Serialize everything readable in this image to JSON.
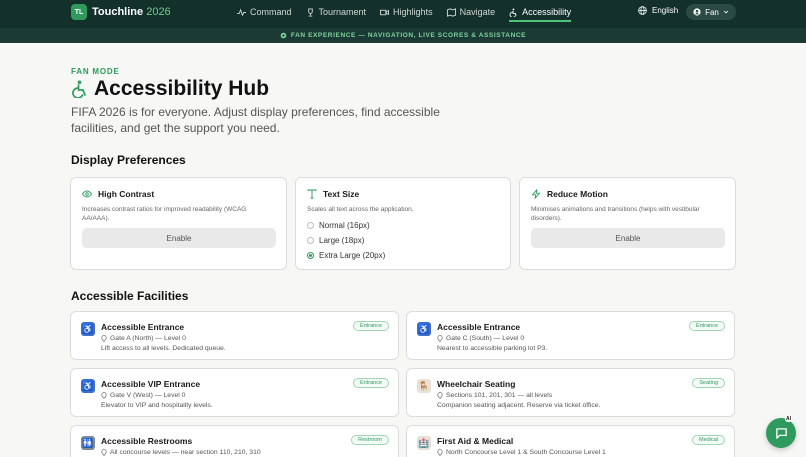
{
  "header": {
    "logo_initials": "TL",
    "brand": "Touchline",
    "brand_year": "2026",
    "nav": [
      {
        "label": "Command",
        "icon": "activity-icon"
      },
      {
        "label": "Tournament",
        "icon": "trophy-icon"
      },
      {
        "label": "Highlights",
        "icon": "video-icon"
      },
      {
        "label": "Navigate",
        "icon": "map-icon"
      },
      {
        "label": "Accessibility",
        "icon": "accessibility-icon",
        "active": true
      }
    ],
    "language": "English",
    "mode_button": "Fan"
  },
  "banner": "FAN EXPERIENCE — NAVIGATION, LIVE SCORES & ASSISTANCE",
  "hero": {
    "eyebrow": "FAN MODE",
    "title": "Accessibility Hub",
    "description": "FIFA 2026 is for everyone. Adjust display preferences, find accessible facilities, and get the support you need."
  },
  "display_preferences": {
    "title": "Display Preferences",
    "high_contrast": {
      "title": "High Contrast",
      "description": "Increases contrast ratios for improved readability (WCAG AA/AAA).",
      "button": "Enable"
    },
    "text_size": {
      "title": "Text Size",
      "description": "Scales all text across the application.",
      "options": [
        "Normal (16px)",
        "Large (18px)",
        "Extra Large (20px)"
      ],
      "selected": "Extra Large (20px)"
    },
    "reduce_motion": {
      "title": "Reduce Motion",
      "description": "Minimises animations and transitions (helps with vestibular disorders).",
      "button": "Enable"
    }
  },
  "facilities": {
    "title": "Accessible Facilities",
    "items": [
      {
        "name": "Accessible Entrance",
        "tag": "Entrance",
        "location": "Gate A (North) — Level 0",
        "note": "Lift access to all levels. Dedicated queue.",
        "icon": "wheelchair-icon"
      },
      {
        "name": "Accessible Entrance",
        "tag": "Entrance",
        "location": "Gate C (South) — Level 0",
        "note": "Nearest to accessible parking lot P3.",
        "icon": "wheelchair-icon"
      },
      {
        "name": "Accessible VIP Entrance",
        "tag": "Entrance",
        "location": "Gate V (West) — Level 0",
        "note": "Elevator to VIP and hospitality levels.",
        "icon": "wheelchair-icon"
      },
      {
        "name": "Wheelchair Seating",
        "tag": "Seating",
        "location": "Sections 101, 201, 301 — all levels",
        "note": "Companion seating adjacent. Reserve via ticket office.",
        "icon": "seat-icon"
      },
      {
        "name": "Accessible Restrooms",
        "tag": "Restroom",
        "location": "All concourse levels — near section 110, 210, 310",
        "note": "",
        "icon": "restroom-icon"
      },
      {
        "name": "First Aid & Medical",
        "tag": "Medical",
        "location": "North Concourse Level 1 & South Concourse Level 1",
        "note": "",
        "icon": "hospital-icon"
      }
    ]
  },
  "chat": {
    "badge": "AI"
  },
  "colors": {
    "accent": "#2e9a5e",
    "topbar": "#14302b",
    "banner": "#1c3a35",
    "facility_icon": "#3a6fd1"
  }
}
